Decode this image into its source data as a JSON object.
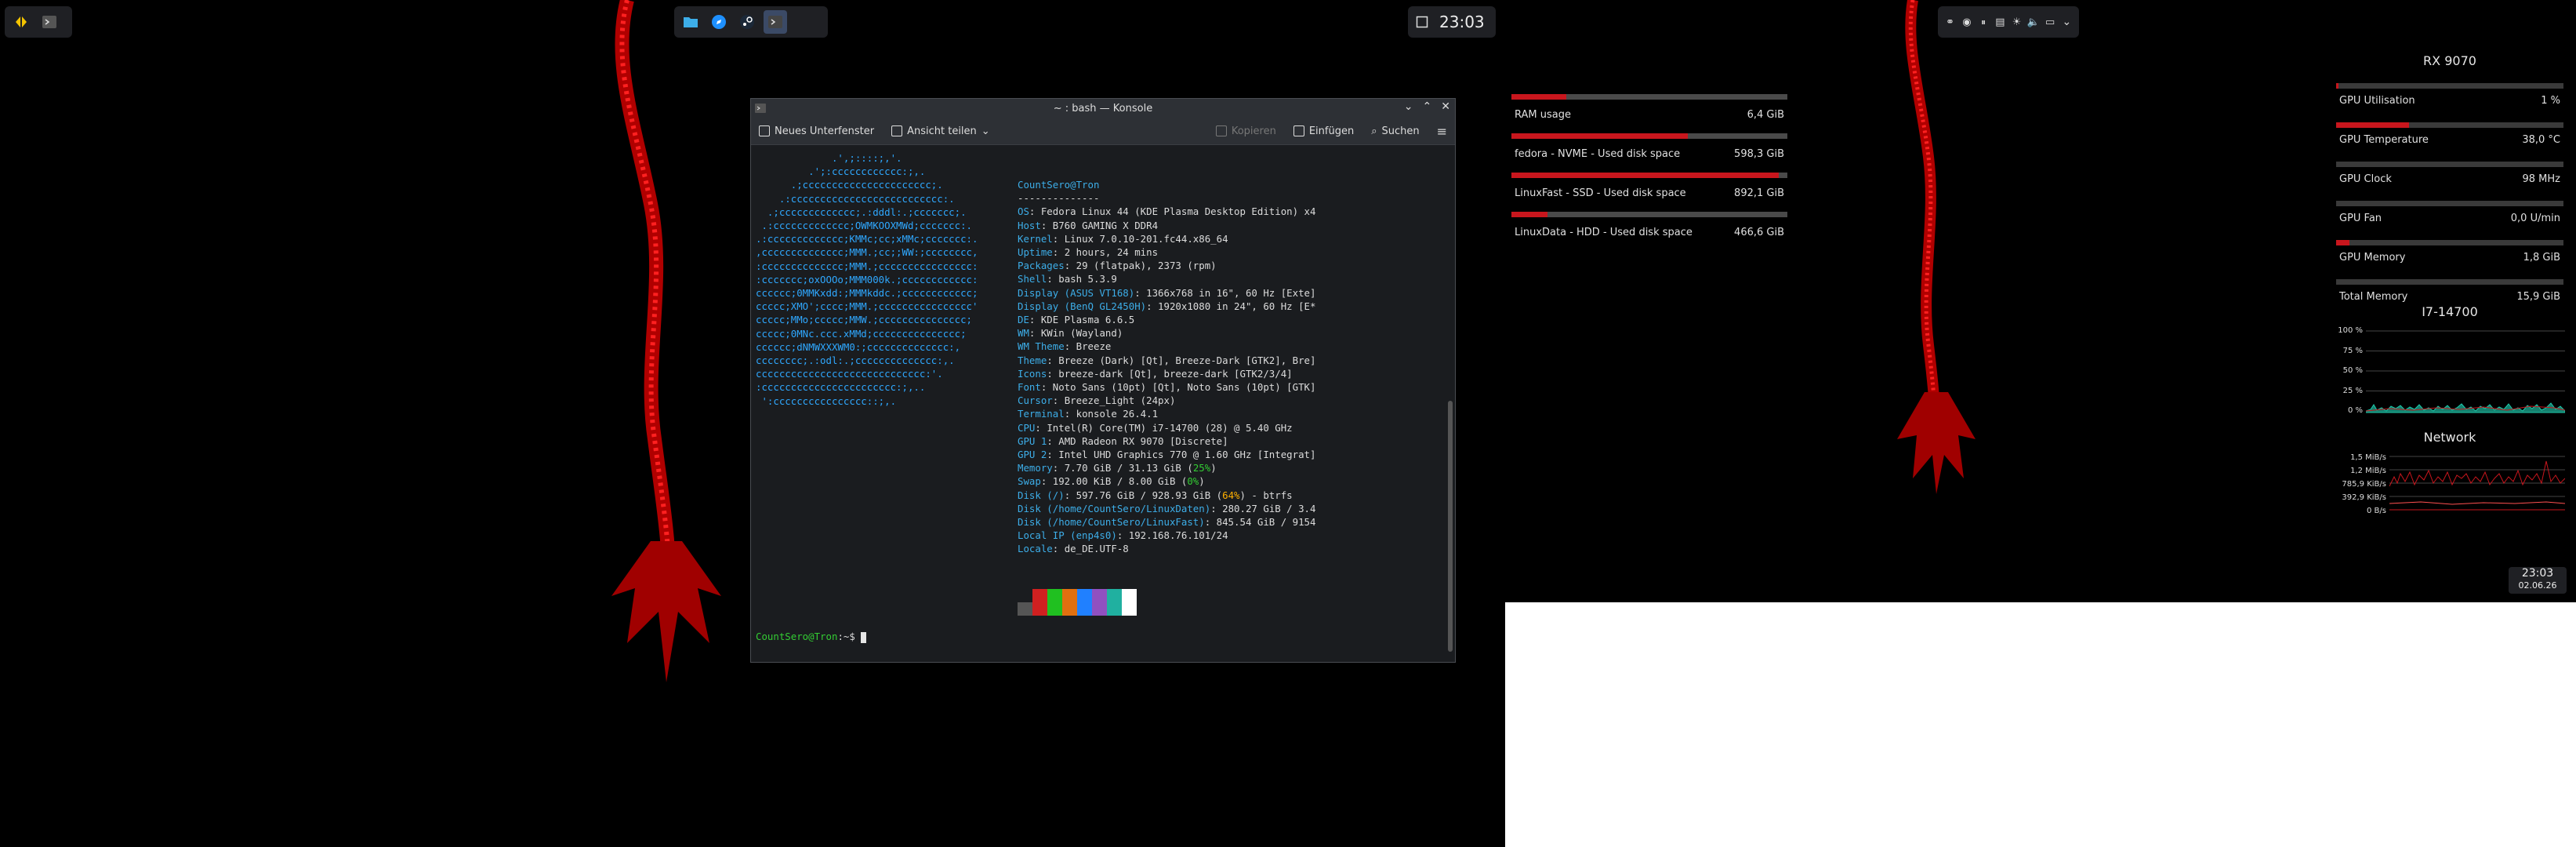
{
  "top_clock": "23:03",
  "konsole": {
    "title": "~ : bash — Konsole",
    "toolbar": {
      "new_tab": "Neues Unterfenster",
      "split_view": "Ansicht teilen",
      "copy": "Kopieren",
      "paste": "Einfügen",
      "search": "Suchen"
    },
    "logo_lines": [
      "             .',;::::;,'.",
      "         .';:cccccccccccc:;,.",
      "      .;cccccccccccccccccccccc;.",
      "    .:cccccccccccccccccccccccccc:.",
      "  .;ccccccccccccc;.:dddl:.;ccccccc;.",
      " .:ccccccccccccc;OWMKOOXMWd;ccccccc:.",
      ".:ccccccccccccc;KMMc;cc;xMMc;ccccccc:.",
      ",cccccccccccccc;MMM.;cc;;WW:;cccccccc,",
      ":cccccccccccccc;MMM.;cccccccccccccccc:",
      ":ccccccc;oxOOOo;MMM000k.;cccccccccccc:",
      "cccccc;0MMKxdd:;MMMkddc.;cccccccccccc;",
      "ccccc;XMO';cccc;MMM.;cccccccccccccccc'",
      "ccccc;MMo;ccccc;MMW.;ccccccccccccccc;",
      "ccccc;0MNc.ccc.xMMd;ccccccccccccccc;",
      "cccccc;dNMWXXXWM0:;cccccccccccccc:,",
      "cccccccc;.:odl:.;cccccccccccccc:,.",
      "ccccccccccccccccccccccccccccc:'.",
      ":ccccccccccccccccccccccc:;,..",
      " ':cccccccccccccccc::;,."
    ],
    "info": {
      "user_host": "CountSero@Tron",
      "separator": "--------------",
      "rows": [
        {
          "k": "OS",
          "v": "Fedora Linux 44 (KDE Plasma Desktop Edition) x4"
        },
        {
          "k": "Host",
          "v": "B760 GAMING X DDR4"
        },
        {
          "k": "Kernel",
          "v": "Linux 7.0.10-201.fc44.x86_64"
        },
        {
          "k": "Uptime",
          "v": "2 hours, 24 mins"
        },
        {
          "k": "Packages",
          "v": "29 (flatpak), 2373 (rpm)"
        },
        {
          "k": "Shell",
          "v": "bash 5.3.9"
        },
        {
          "k": "Display (ASUS VT168)",
          "v": "1366x768 in 16\", 60 Hz [Exte]"
        },
        {
          "k": "Display (BenQ GL2450H)",
          "v": "1920x1080 in 24\", 60 Hz [E*"
        },
        {
          "k": "DE",
          "v": "KDE Plasma 6.6.5"
        },
        {
          "k": "WM",
          "v": "KWin (Wayland)"
        },
        {
          "k": "WM Theme",
          "v": "Breeze"
        },
        {
          "k": "Theme",
          "v": "Breeze (Dark) [Qt], Breeze-Dark [GTK2], Bre]"
        },
        {
          "k": "Icons",
          "v": "breeze-dark [Qt], breeze-dark [GTK2/3/4]"
        },
        {
          "k": "Font",
          "v": "Noto Sans (10pt) [Qt], Noto Sans (10pt) [GTK]"
        },
        {
          "k": "Cursor",
          "v": "Breeze_Light (24px)"
        },
        {
          "k": "Terminal",
          "v": "konsole 26.4.1"
        },
        {
          "k": "CPU",
          "v": "Intel(R) Core(TM) i7-14700 (28) @ 5.40 GHz"
        },
        {
          "k": "GPU 1",
          "v": "AMD Radeon RX 9070 [Discrete]"
        },
        {
          "k": "GPU 2",
          "v": "Intel UHD Graphics 770 @ 1.60 GHz [Integrat]"
        },
        {
          "k": "Memory",
          "v": "7.70 GiB / 31.13 GiB",
          "pct": "25%",
          "pct_color": "g"
        },
        {
          "k": "Swap",
          "v": "192.00 KiB / 8.00 GiB",
          "pct": "0%",
          "pct_color": "g"
        },
        {
          "k": "Disk (/)",
          "v": "597.76 GiB / 928.93 GiB",
          "pct": "64%",
          "tail": " - btrfs",
          "pct_color": "y"
        },
        {
          "k": "Disk (/home/CountSero/LinuxDaten)",
          "v": "280.27 GiB / 3.4"
        },
        {
          "k": "Disk (/home/CountSero/LinuxFast)",
          "v": "845.54 GiB / 9154"
        },
        {
          "k": "Local IP (enp4s0)",
          "v": "192.168.76.101/24"
        },
        {
          "k": "Locale",
          "v": "de_DE.UTF-8"
        }
      ]
    },
    "palette": [
      "#555555",
      "#d02020",
      "#20c020",
      "#e07010",
      "#2080ff",
      "#9050c0",
      "#20b0a0",
      "#ffffff"
    ],
    "prompt_user": "CountSero@Tron",
    "prompt_rest": ":~$ "
  },
  "disks": [
    {
      "label": "RAM usage",
      "value": "6,4 GiB",
      "fill": 0.2
    },
    {
      "label": "fedora - NVME - Used disk space",
      "value": "598,3 GiB",
      "fill": 0.64
    },
    {
      "label": "LinuxFast - SSD - Used disk space",
      "value": "892,1 GiB",
      "fill": 0.97
    },
    {
      "label": "LinuxData - HDD - Used disk space",
      "value": "466,6 GiB",
      "fill": 0.13
    }
  ],
  "gpu": {
    "title": "RX 9070",
    "items": [
      {
        "label": "GPU Utilisation",
        "value": "1 %",
        "fill": 0.01
      },
      {
        "label": "GPU Temperature",
        "value": "38,0 °C",
        "fill": 0.32
      },
      {
        "label": "GPU Clock",
        "value": "98 MHz",
        "fill": 0.0
      },
      {
        "label": "GPU Fan",
        "value": "0,0 U/min",
        "fill": 0.0
      },
      {
        "label": "GPU Memory",
        "value": "1,8 GiB",
        "fill": 0.06
      },
      {
        "label": "Total Memory",
        "value": "15,9 GiB",
        "fill": 0.0
      }
    ]
  },
  "cpu": {
    "title": "I7-14700",
    "axis": [
      "100 %",
      "75 %",
      "50 %",
      "25 %",
      "0 %"
    ]
  },
  "network": {
    "title": "Network",
    "axis": [
      "1,5 MiB/s",
      "1,2 MiB/s",
      "785,9 KiB/s",
      "392,9 KiB/s",
      "0 B/s"
    ]
  },
  "bottom_clock": {
    "time": "23:03",
    "date": "02.06.26"
  }
}
